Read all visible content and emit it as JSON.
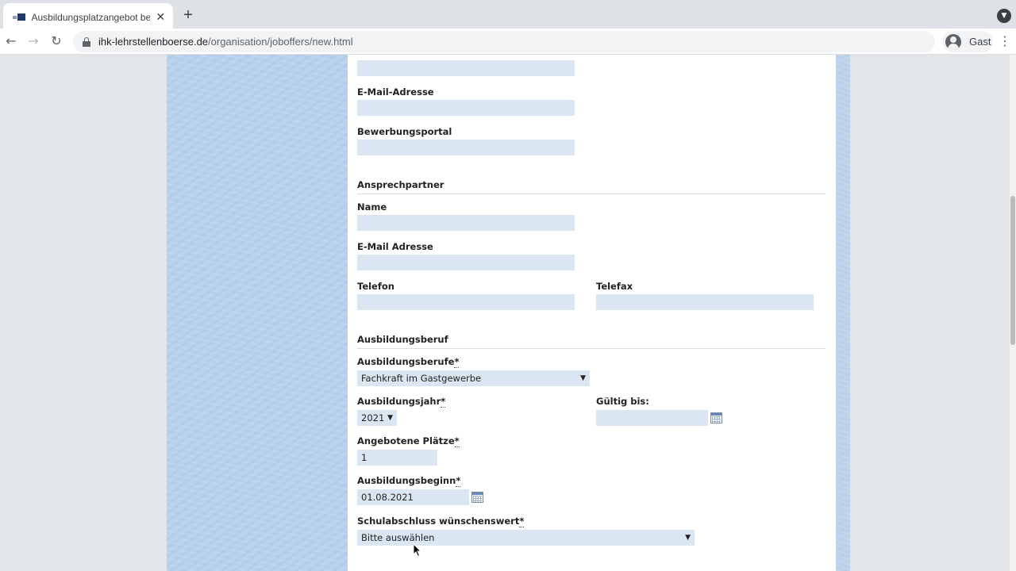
{
  "browser": {
    "tab_title": "Ausbildungsplatzangebot bear",
    "tab_close": "✕",
    "new_tab": "+",
    "url_host": "ihk-lehrstellenboerse.de",
    "url_path": "/organisation/joboffers/new.html",
    "profile_label": "Gast",
    "back_icon": "←",
    "forward_icon": "→",
    "reload_icon": "↻",
    "menu_icon": "⋮",
    "tab_search_icon": "▼"
  },
  "form": {
    "top_fields": [
      {
        "label": "E-Mail-Adresse",
        "value": ""
      },
      {
        "label": "Bewerbungsportal",
        "value": ""
      }
    ],
    "contact": {
      "section_title": "Ansprechpartner",
      "name_label": "Name",
      "name_value": "",
      "email_label": "E-Mail Adresse",
      "email_value": "",
      "phone_label": "Telefon",
      "phone_value": "",
      "fax_label": "Telefax",
      "fax_value": ""
    },
    "training": {
      "section_title": "Ausbildungsberuf",
      "profession_label": "Ausbildungsberufe",
      "profession_value": "Fachkraft im Gastgewerbe",
      "year_label": "Ausbildungsjahr",
      "year_value": "2021",
      "valid_until_label": "Gültig bis:",
      "valid_until_value": "",
      "places_label": "Angebotene Plätze",
      "places_value": "1",
      "start_label": "Ausbildungsbeginn",
      "start_value": "01.08.2021",
      "school_label": "Schulabschluss wünschenswert",
      "school_value": "Bitte auswählen",
      "required_marker": "*"
    }
  },
  "colors": {
    "input_bg": "#dbe6f3",
    "side_panel": "#b9d1ea",
    "page_bg": "#e3e6e8"
  }
}
